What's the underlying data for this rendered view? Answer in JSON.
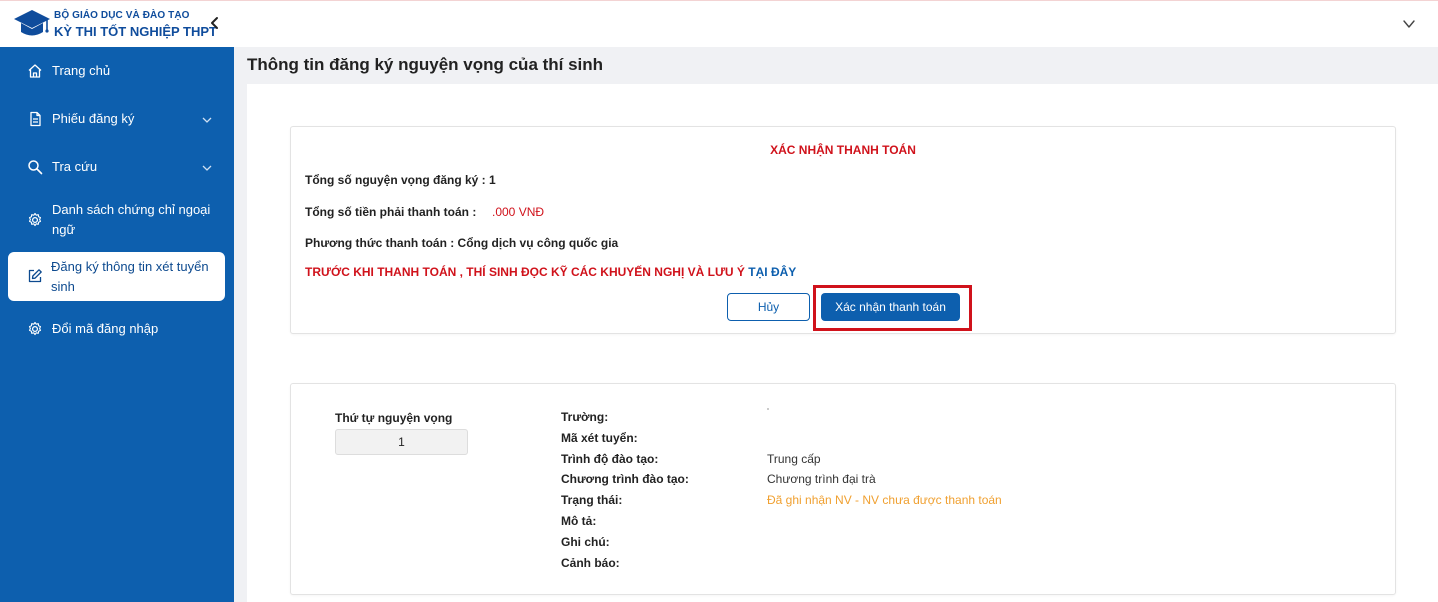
{
  "header": {
    "brand_line1": "BỘ GIÁO DỤC VÀ ĐÀO TẠO",
    "brand_line2": "KỲ THI TỐT NGHIỆP THPT"
  },
  "sidebar": {
    "items": [
      {
        "label": "Trang chủ",
        "icon": "home-icon"
      },
      {
        "label": "Phiếu đăng ký",
        "icon": "document-icon"
      },
      {
        "label": "Tra cứu",
        "icon": "search-icon"
      },
      {
        "label": "Danh sách chứng chỉ ngoại ngữ",
        "icon": "gear-icon"
      },
      {
        "label": "Đăng ký thông tin xét tuyển sinh",
        "icon": "edit-icon",
        "active": true
      },
      {
        "label": "Đổi mã đăng nhập",
        "icon": "gear-icon"
      }
    ]
  },
  "page": {
    "title": "Thông tin đăng ký nguyện vọng của thí sinh"
  },
  "payment": {
    "title": "XÁC NHẬN THANH TOÁN",
    "total_wishes": "Tổng số nguyện vọng đăng ký : 1",
    "total_amount_label": "Tổng số tiền phải thanh toán :",
    "total_amount_value": ".000 VNĐ",
    "method": "Phương thức thanh toán : Cổng dịch vụ công quốc gia",
    "warning_text": "TRƯỚC KHI THANH TOÁN , THÍ SINH ĐỌC KỸ CÁC KHUYẾN NGHỊ VÀ LƯU Ý ",
    "warning_link": "TẠI ĐÂY",
    "cancel_label": "Hủy",
    "confirm_label": "Xác nhận thanh toán"
  },
  "wish": {
    "order_label": "Thứ tự nguyện vọng",
    "order_value": "1",
    "fields": [
      {
        "label": "Trường:",
        "value": ""
      },
      {
        "label": "Mã xét tuyển:",
        "value": ""
      },
      {
        "label": "Trình độ đào tạo:",
        "value": "Trung cấp"
      },
      {
        "label": "Chương trình đào tạo:",
        "value": "Chương trình đại trà"
      },
      {
        "label": "Trạng thái:",
        "value": "Đã ghi nhận NV - NV chưa được thanh toán"
      },
      {
        "label": "Mô tả:",
        "value": ""
      },
      {
        "label": "Ghi chú:",
        "value": ""
      },
      {
        "label": "Cảnh báo:",
        "value": ""
      }
    ]
  },
  "colors": {
    "primary": "#0d5fae",
    "danger": "#d0121b",
    "status": "#f0a030"
  }
}
